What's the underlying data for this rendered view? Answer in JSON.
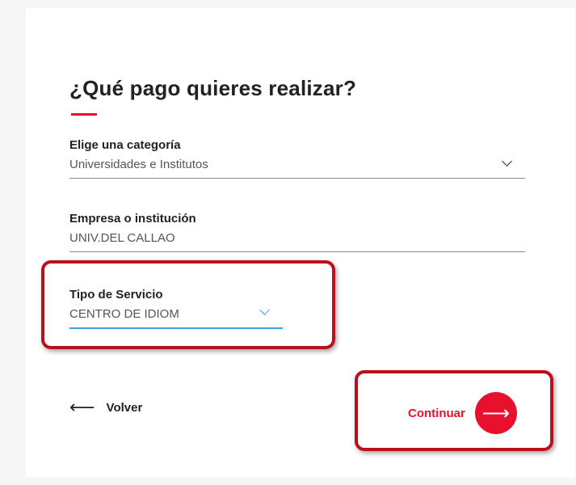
{
  "form": {
    "title": "¿Qué pago quieres realizar?",
    "category": {
      "label": "Elige una categoría",
      "value": "Universidades e Institutos"
    },
    "company": {
      "label": "Empresa o institución",
      "value": "UNIV.DEL CALLAO"
    },
    "service": {
      "label": "Tipo de Servicio",
      "value": "CENTRO DE IDIOM"
    }
  },
  "actions": {
    "back_label": "Volver",
    "continue_label": "Continuar"
  },
  "icons": {
    "back": "arrow-left-icon",
    "continue": "arrow-right-icon",
    "dropdown": "chevron-down-icon"
  },
  "colors": {
    "accent": "#e8112d",
    "highlight": "#b8111c",
    "active_underline": "#3aa6d8"
  }
}
